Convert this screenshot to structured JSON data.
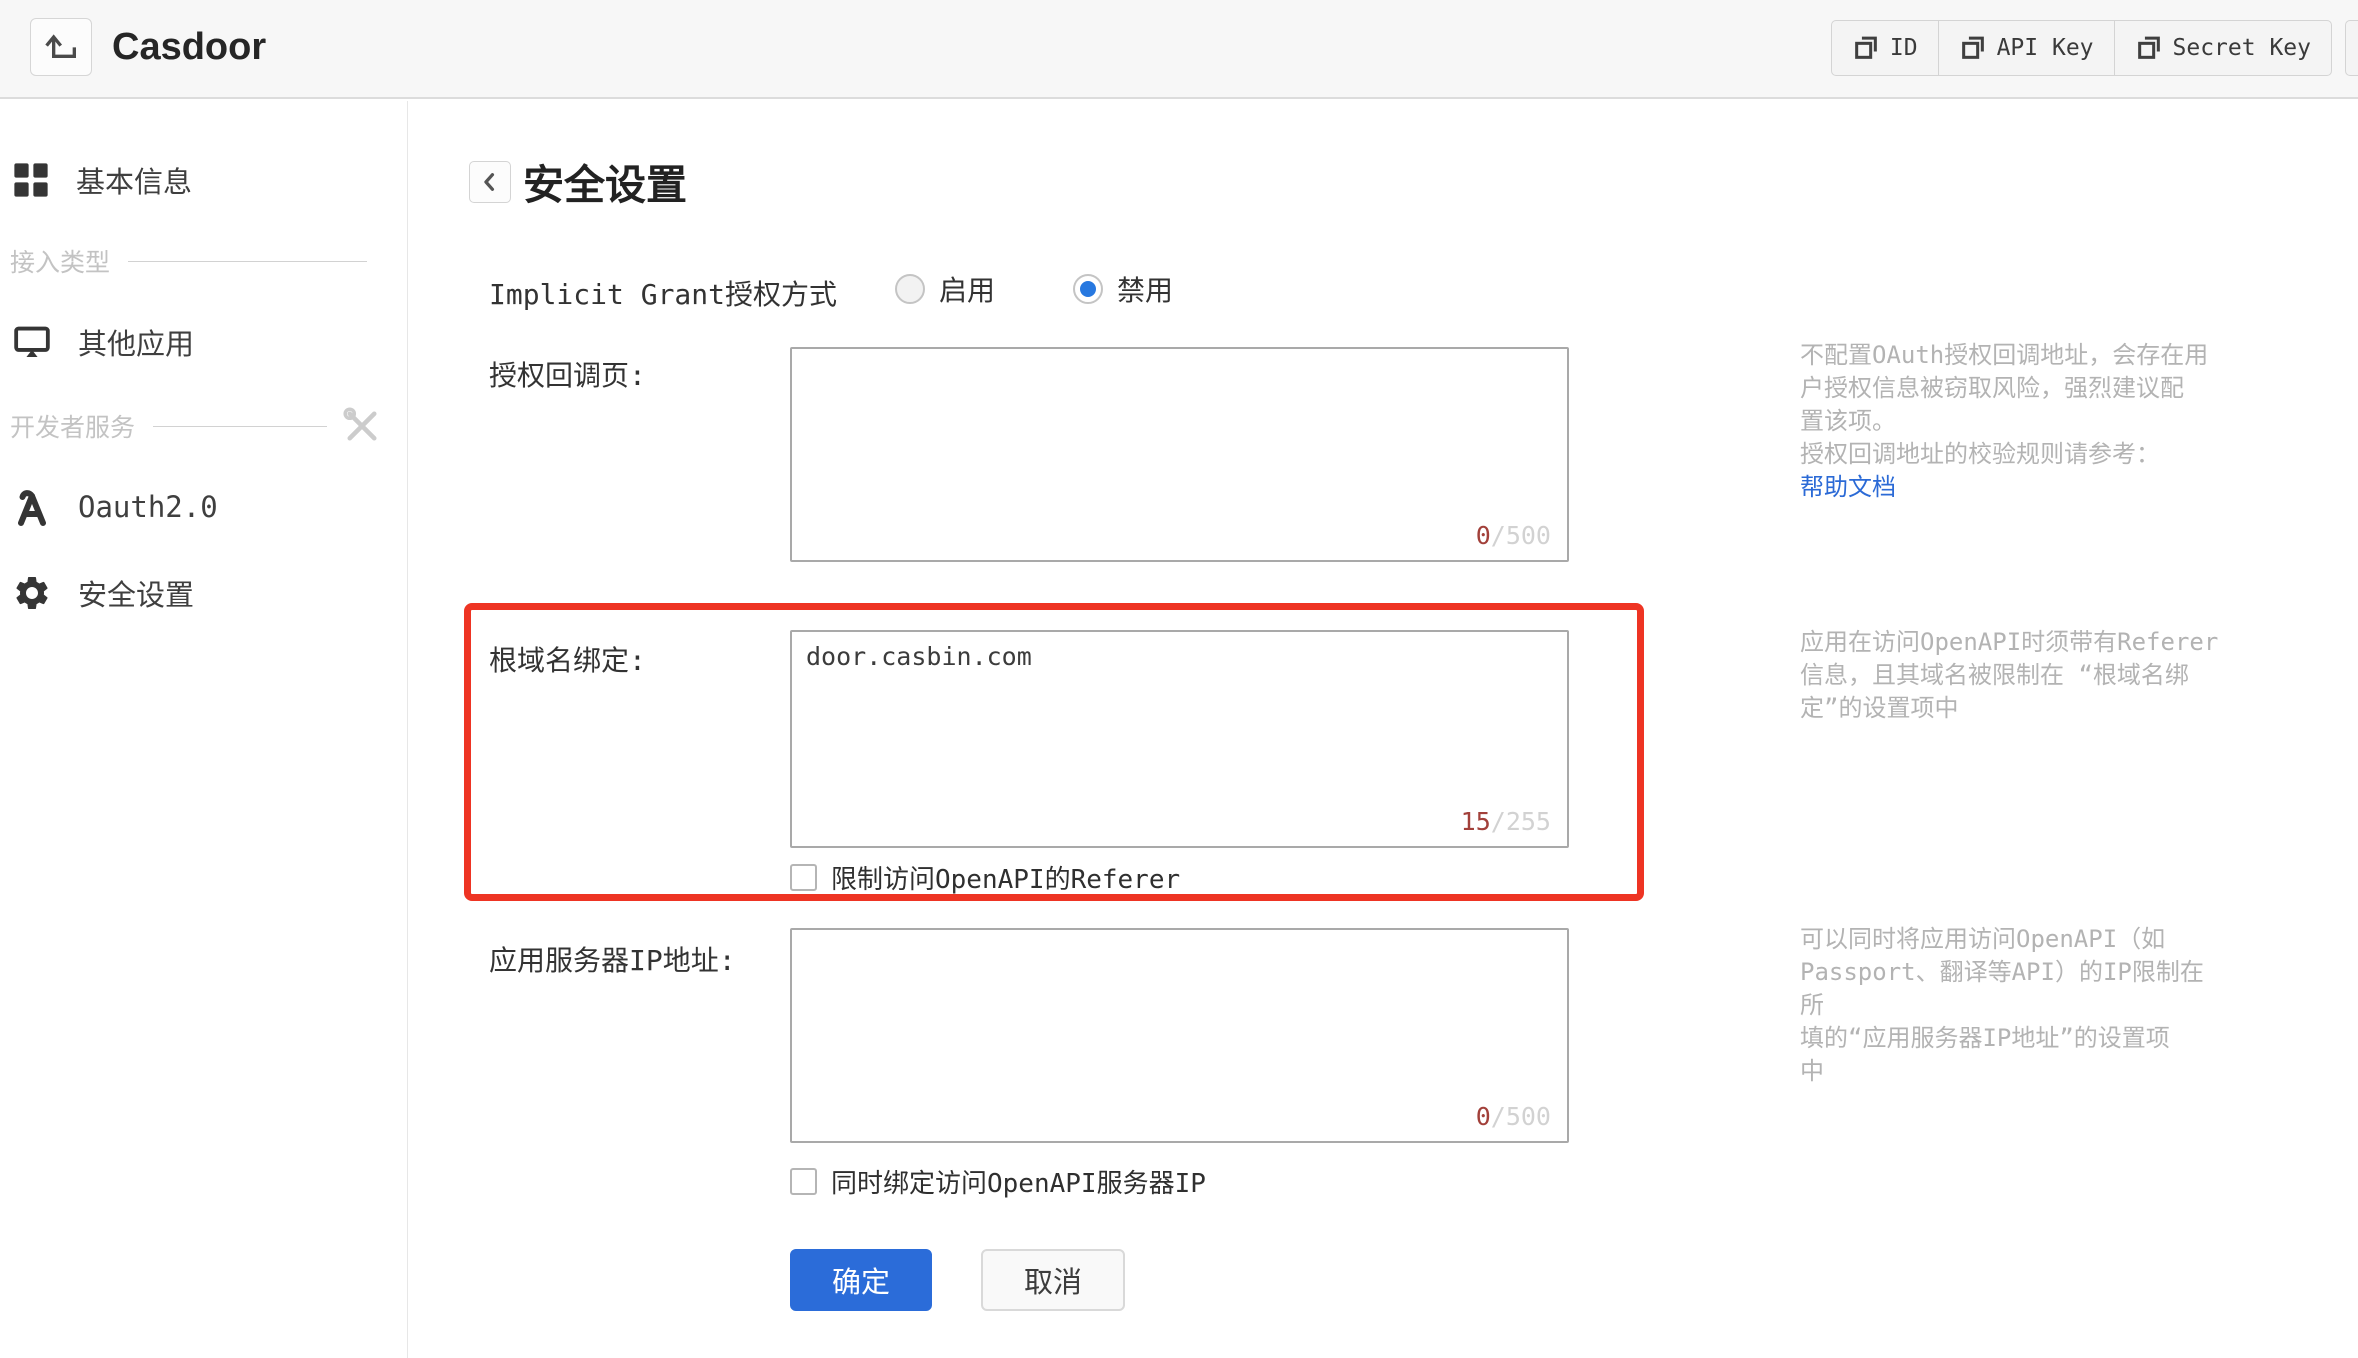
{
  "colors": {
    "accent_blue": "#2b6cd9",
    "radio_blue": "#2778e0",
    "link_blue": "#2b6ad6",
    "highlight_red": "#ee3423",
    "counter_red": "#a2403a"
  },
  "header": {
    "title": "Casdoor",
    "back_icon": "return-up-icon",
    "actions": [
      {
        "label": "ID",
        "icon": "copy-icon"
      },
      {
        "label": "API Key",
        "icon": "copy-icon"
      },
      {
        "label": "Secret Key",
        "icon": "copy-icon"
      }
    ]
  },
  "sidebar": {
    "items": [
      {
        "label": "基本信息",
        "icon": "grid-icon"
      },
      {
        "label": "接入类型",
        "type": "divider"
      },
      {
        "label": "其他应用",
        "icon": "monitor-icon"
      },
      {
        "label": "开发者服务",
        "type": "divider",
        "icon": "tools-icon"
      },
      {
        "label": "Oauth2.0",
        "icon": "api-icon"
      },
      {
        "label": "安全设置",
        "icon": "gear-icon"
      }
    ]
  },
  "main": {
    "page_title": "安全设置",
    "implicit_grant": {
      "label": "Implicit Grant授权方式",
      "options": [
        {
          "label": "启用",
          "selected": false
        },
        {
          "label": "禁用",
          "selected": true
        }
      ]
    },
    "callback_field": {
      "label": "授权回调页:",
      "value": "",
      "counter_current": "0",
      "counter_max": "/500",
      "help_lines": [
        "不配置OAuth授权回调地址，会存在用",
        "户授权信息被窃取风险，强烈建议配",
        "置该项。",
        "授权回调地址的校验规则请参考："
      ],
      "help_link": "帮助文档"
    },
    "domain_field": {
      "label": "根域名绑定:",
      "value": "door.casbin.com",
      "counter_current": "15",
      "counter_max": "/255",
      "checkbox_label": "限制访问OpenAPI的Referer",
      "checkbox_checked": false,
      "help_lines": [
        "应用在访问OpenAPI时须带有Referer",
        "信息，且其域名被限制在 “根域名绑",
        "定”的设置项中"
      ]
    },
    "ip_field": {
      "label": "应用服务器IP地址:",
      "value": "",
      "counter_current": "0",
      "counter_max": "/500",
      "checkbox_label": "同时绑定访问OpenAPI服务器IP",
      "checkbox_checked": false,
      "help_lines": [
        "可以同时将应用访问OpenAPI（如",
        "Passport、翻译等API）的IP限制在所",
        "填的“应用服务器IP地址”的设置项",
        "中"
      ]
    },
    "buttons": {
      "ok": "确定",
      "cancel": "取消"
    }
  }
}
